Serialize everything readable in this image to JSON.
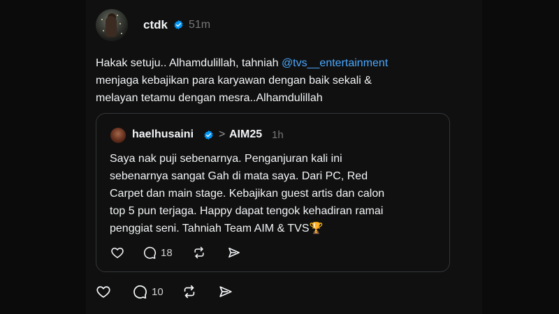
{
  "post": {
    "username": "ctdk",
    "timestamp": "51m",
    "text_lines": {
      "l1_prefix": "Hakak setuju.. Alhamdulillah, tahniah ",
      "l1_mention": "@tvs__entertainment",
      "l2": "menjaga kebajikan para karyawan dengan baik sekali &",
      "l3": "melayan tetamu dengan mesra..Alhamdulillah"
    },
    "actions": {
      "replies": "10"
    }
  },
  "quoted": {
    "username": "haelhusaini",
    "separator": ">",
    "topic": "AIM25",
    "timestamp": "1h",
    "text_lines": [
      "Saya nak puji sebenarnya. Penganjuran kali ini",
      "sebenarnya sangat Gah di mata saya. Dari PC, Red",
      "Carpet dan main stage. Kebajikan guest artis dan calon",
      "top 5 pun terjaga. Happy dapat tengok kehadiran ramai",
      "penggiat seni. Tahniah Team AIM & TVS🏆"
    ],
    "actions": {
      "replies": "18"
    }
  },
  "colors": {
    "accent_link": "#4aa8ff",
    "verified": "#0095f6",
    "text": "#f3f5f7",
    "muted": "#777777",
    "background": "#101010"
  },
  "icons": [
    "verified-badge-icon",
    "heart-icon",
    "comment-icon",
    "repost-icon",
    "share-icon",
    "chevron-right-icon",
    "trophy-emoji"
  ]
}
